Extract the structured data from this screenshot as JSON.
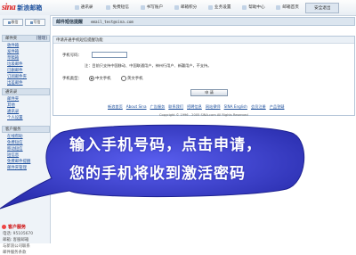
{
  "topbar": {
    "logo_mark": "sina",
    "logo_text": "新浪邮箱",
    "nav": [
      "通讯录",
      "免费短信",
      "书写账户",
      "邮箱积分",
      "业务设置",
      "帮助中心",
      "邮箱首页",
      "安全退出"
    ]
  },
  "sidebar": {
    "write_btn": "收信",
    "compose_btn": "写信",
    "folder_header": "邮件夹",
    "folder_header_link": "[管理]",
    "folders": [
      "收件箱",
      "发件箱",
      "草稿箱",
      "垃圾邮件",
      "已删邮件",
      "订阅邮件夹",
      "出差邮件"
    ],
    "extra_header": "通讯录",
    "extra": [
      "邮件夹",
      "其他",
      "通讯录",
      "个人设置"
    ],
    "lower": [
      "客户服务",
      "在线帮助",
      "免费短信",
      "移动短信",
      "短信息",
      "免费邮件提醒",
      "邮件夹管理"
    ],
    "hotline_title": "客户服务",
    "hotline": [
      "电话: 95105670",
      "邮箱: 客服邮箱",
      "与新浪公司联系",
      "邮件服务条款"
    ]
  },
  "main": {
    "title": "邮件短信提醒",
    "email": "email_test@sina.com",
    "panel_title": "申请开通手机短信提醒功能",
    "phone_label": "手机号码：",
    "phone_value": "",
    "hint": "注：目前只支持中国移动、中国联通用户，神州行用户、新疆用户，不支持。",
    "type_label": "手机类型：",
    "type_options": [
      "中文手机",
      "英文手机"
    ],
    "apply_label": "申 请",
    "footer_links": [
      "新浪首页",
      "About Sina",
      "广告服务",
      "联系我们",
      "招聘信息",
      "网站律师",
      "SINA English",
      "会员注册",
      "产品答疑"
    ],
    "copyright": "Copyright © 1996 - 2005 SINA.com All Rights Reserved"
  },
  "callout": {
    "line1": "输入手机号码，点击申请，",
    "line2": "您的手机将收到激活密码",
    "fill_color": "#3a3fcf"
  }
}
